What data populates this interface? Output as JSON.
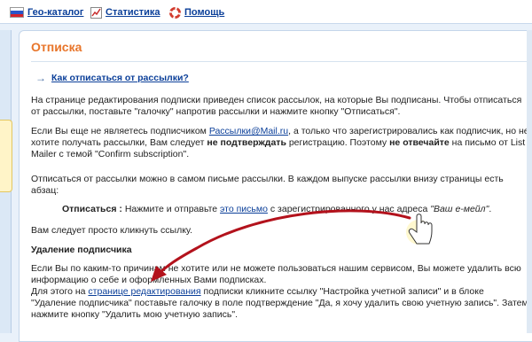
{
  "nav": [
    {
      "label": "Гео-каталог",
      "icon": "russia-flag-icon"
    },
    {
      "label": "Статистика",
      "icon": "chart-icon"
    },
    {
      "label": "Помощь",
      "icon": "lifebuoy-icon"
    }
  ],
  "page": {
    "title": "Отписка",
    "howto_link": "Как отписаться от рассылки?",
    "p1": "На странице редактирования подписки приведен список рассылок, на которые Вы подписаны. Чтобы отписаться от рассылки, поставьте \"галочку\" напротив рассылки и нажмите кнопку \"Отписаться\".",
    "p2": {
      "a": "Если Вы еще не являетесь подписчиком ",
      "link": "Рассылки@Mail.ru",
      "b": ", а только что зарегистрировались как подписчик, но не хотите получать рассылки, Вам следует ",
      "bold1": "не подтверждать",
      "c": " регистрацию. Поэтому ",
      "bold2": "не отвечайте",
      "d": " на письмо от List Mailer с темой \"Confirm subscription\"."
    },
    "p3": "Отписаться от рассылки можно в самом письме рассылки. В каждом выпуске рассылки внизу страницы есть абзац:",
    "quote": {
      "lead": "Отписаться :",
      "a": " Нажмите и отправьте ",
      "link": "это письмо",
      "b": " с зарегистрированного у нас адреса ",
      "italic": "\"Ваш е-мейл\"",
      "c": "."
    },
    "p4": "Вам следует просто кликнуть ссылку.",
    "subhead": "Удаление подписчика",
    "p5": "Если Вы по каким-то причинам не хотите или не можете пользоваться нашим сервисом, Вы можете удалить всю информацию о себе и оформленных Вами подписках.",
    "p6": {
      "a": "Для этого на ",
      "link": "странице редактирования",
      "b": " подписки кликните ссылку \"Настройка учетной записи\" и в блоке \"Удаление подписчика\" поставьте галочку в поле подтверждение \"Да, я хочу удалить свою учетную запись\". Затем нажмите кнопку \"Удалить мою учетную запись\"."
    }
  },
  "colors": {
    "title": "#e8752a",
    "link": "#0b3f99",
    "arrow": "#b3121c"
  }
}
